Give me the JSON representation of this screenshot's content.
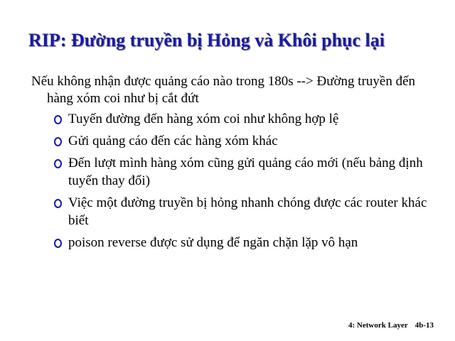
{
  "slide": {
    "title": "RIP: Đường truyền bị Hỏng và Khôi phục lại",
    "intro": "Nếu không nhận được quảng cáo nào trong 180s --> Đường truyền đến hàng xóm coi như bị cắt đứt",
    "bullets": [
      "Tuyến đường đến hàng xóm coi như không hợp lệ",
      "Gửi quảng cáo đến các hàng xóm khác",
      "Đến lượt mình hàng xóm cũng gửi quảng cáo mới (nếu bảng định tuyến thay đổi)",
      "Việc một đường truyền bị hỏng nhanh chóng được các router khác biết",
      "poison reverse được sử dụng để ngăn chặn lặp vô hạn"
    ],
    "footer": {
      "chapter": "4: Network Layer",
      "page": "4b-13"
    }
  },
  "colors": {
    "title": "#1a1aa6",
    "bullet": "#1a1aa6",
    "text": "#000000",
    "background": "#ffffff"
  }
}
